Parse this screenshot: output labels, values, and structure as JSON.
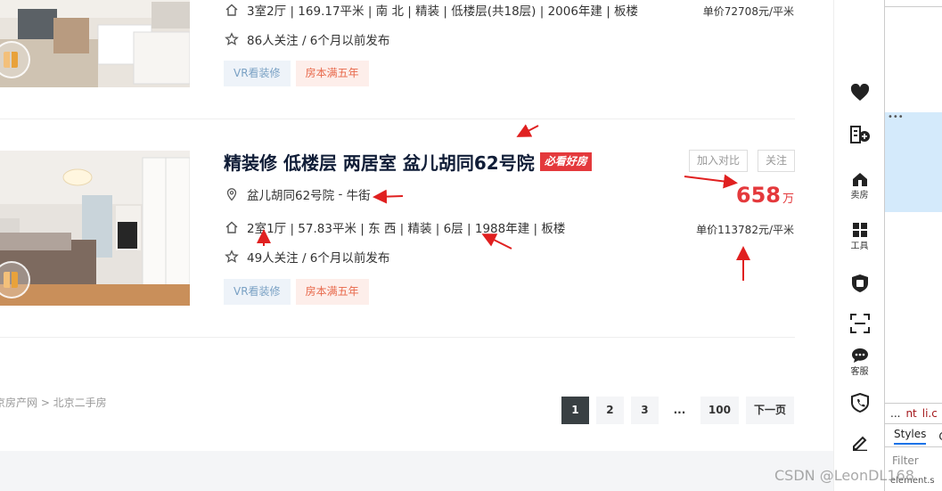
{
  "listings": [
    {
      "info_line": "3室2厅 | 169.17平米 | 南 北 | 精装 | 低楼层(共18层) | 2006年建 | 板楼",
      "follow_line": "86人关注 / 6个月以前发布",
      "tags": [
        "VR看装修",
        "房本满五年"
      ],
      "unit_price": "单价72708元/平米"
    },
    {
      "title": "精装修 低楼层 两居室 盆儿胡同62号院",
      "badge": "必看好房",
      "compare_label": "加入对比",
      "follow_label": "关注",
      "community": "盆儿胡同62号院",
      "separator": " - ",
      "district": "牛街",
      "info_line": "2室1厅 | 57.83平米 | 东 西 | 精装 | 6层 | 1988年建 | 板楼",
      "follow_line": "49人关注 / 6个月以前发布",
      "tags": [
        "VR看装修",
        "房本满五年"
      ],
      "price_value": "658",
      "price_unit": "万",
      "unit_price": "单价113782元/平米"
    }
  ],
  "breadcrumb": "京房产网 > 北京二手房",
  "pagination": {
    "pages": [
      "1",
      "2",
      "3",
      "...",
      "100"
    ],
    "active": "1",
    "next_label": "下一页"
  },
  "sidebar": {
    "items": [
      {
        "icon": "heart-icon",
        "label": ""
      },
      {
        "icon": "building-calculator-icon",
        "label": ""
      },
      {
        "icon": "sell-house-icon",
        "label": "卖房"
      },
      {
        "icon": "tools-grid-icon",
        "label": "工具"
      },
      {
        "icon": "shield-badge-icon",
        "label": ""
      },
      {
        "icon": "scan-icon",
        "label": ""
      },
      {
        "icon": "chat-icon",
        "label": "客服"
      },
      {
        "icon": "phone-shield-icon",
        "label": ""
      },
      {
        "icon": "edit-pen-icon",
        "label": ""
      }
    ]
  },
  "devtools": {
    "dots": "•••",
    "bar_dots": "...",
    "bar_text_1": "nt",
    "bar_text_2": "li.c",
    "tab_styles": "Styles",
    "tab_next": "C",
    "filter_placeholder": "Filter",
    "element_style": "element.s"
  },
  "watermark": "CSDN @LeonDL168",
  "colors": {
    "accent_red": "#e4393c",
    "title_navy": "#101d37",
    "pager_active": "#394043",
    "annotation_arrow": "#e02020"
  }
}
